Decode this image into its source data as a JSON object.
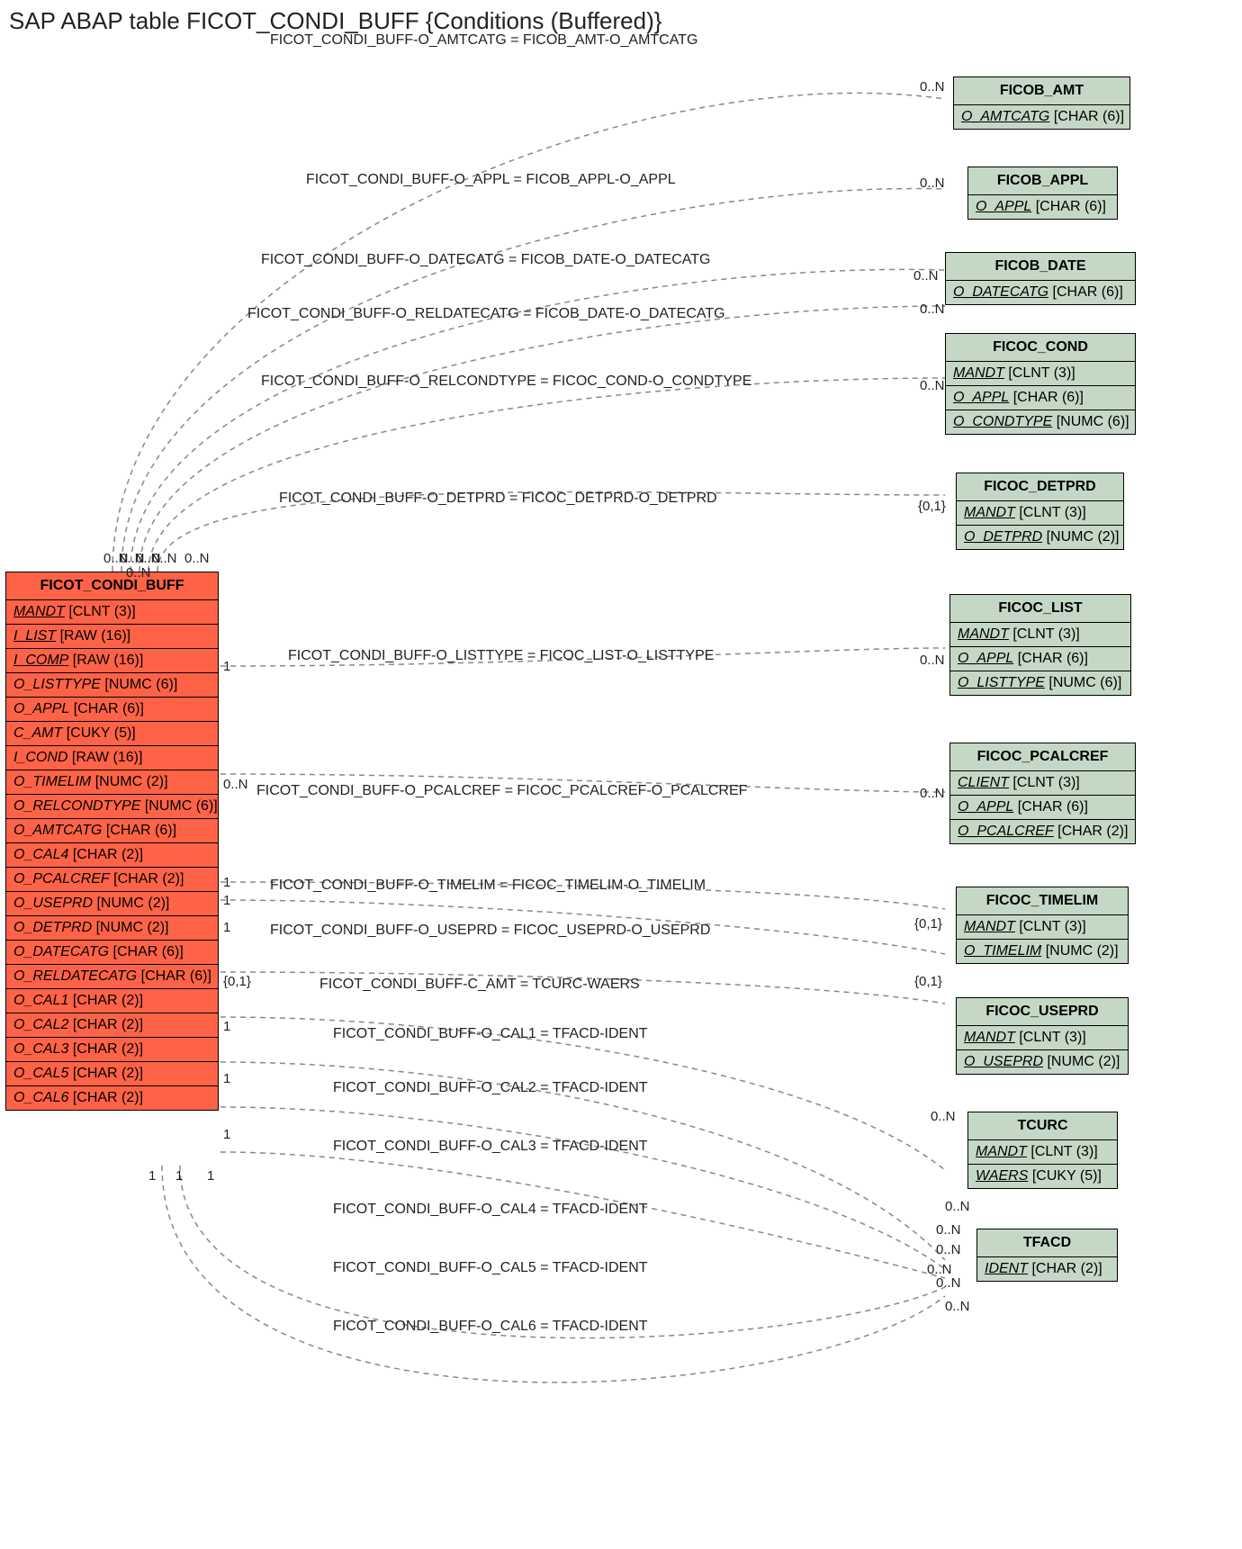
{
  "title": "SAP ABAP table FICOT_CONDI_BUFF {Conditions (Buffered)}",
  "main": {
    "name": "FICOT_CONDI_BUFF",
    "fields": [
      {
        "name": "MANDT",
        "type": "[CLNT (3)]",
        "key": true
      },
      {
        "name": "I_LIST",
        "type": "[RAW (16)]",
        "key": true
      },
      {
        "name": "I_COMP",
        "type": "[RAW (16)]",
        "key": true
      },
      {
        "name": "O_LISTTYPE",
        "type": "[NUMC (6)]",
        "key": false
      },
      {
        "name": "O_APPL",
        "type": "[CHAR (6)]",
        "key": false
      },
      {
        "name": "C_AMT",
        "type": "[CUKY (5)]",
        "key": false
      },
      {
        "name": "I_COND",
        "type": "[RAW (16)]",
        "key": false
      },
      {
        "name": "O_TIMELIM",
        "type": "[NUMC (2)]",
        "key": false
      },
      {
        "name": "O_RELCONDTYPE",
        "type": "[NUMC (6)]",
        "key": false
      },
      {
        "name": "O_AMTCATG",
        "type": "[CHAR (6)]",
        "key": false
      },
      {
        "name": "O_CAL4",
        "type": "[CHAR (2)]",
        "key": false
      },
      {
        "name": "O_PCALCREF",
        "type": "[CHAR (2)]",
        "key": false
      },
      {
        "name": "O_USEPRD",
        "type": "[NUMC (2)]",
        "key": false
      },
      {
        "name": "O_DETPRD",
        "type": "[NUMC (2)]",
        "key": false
      },
      {
        "name": "O_DATECATG",
        "type": "[CHAR (6)]",
        "key": false
      },
      {
        "name": "O_RELDATECATG",
        "type": "[CHAR (6)]",
        "key": false
      },
      {
        "name": "O_CAL1",
        "type": "[CHAR (2)]",
        "key": false
      },
      {
        "name": "O_CAL2",
        "type": "[CHAR (2)]",
        "key": false
      },
      {
        "name": "O_CAL3",
        "type": "[CHAR (2)]",
        "key": false
      },
      {
        "name": "O_CAL5",
        "type": "[CHAR (2)]",
        "key": false
      },
      {
        "name": "O_CAL6",
        "type": "[CHAR (2)]",
        "key": false
      }
    ]
  },
  "refs": [
    {
      "name": "FICOB_AMT",
      "fields": [
        {
          "name": "O_AMTCATG",
          "type": "[CHAR (6)]",
          "key": true
        }
      ]
    },
    {
      "name": "FICOB_APPL",
      "fields": [
        {
          "name": "O_APPL",
          "type": "[CHAR (6)]",
          "key": true
        }
      ]
    },
    {
      "name": "FICOB_DATE",
      "fields": [
        {
          "name": "O_DATECATG",
          "type": "[CHAR (6)]",
          "key": true
        }
      ]
    },
    {
      "name": "FICOC_COND",
      "fields": [
        {
          "name": "MANDT",
          "type": "[CLNT (3)]",
          "key": true
        },
        {
          "name": "O_APPL",
          "type": "[CHAR (6)]",
          "key": true
        },
        {
          "name": "O_CONDTYPE",
          "type": "[NUMC (6)]",
          "key": true
        }
      ]
    },
    {
      "name": "FICOC_DETPRD",
      "fields": [
        {
          "name": "MANDT",
          "type": "[CLNT (3)]",
          "key": true
        },
        {
          "name": "O_DETPRD",
          "type": "[NUMC (2)]",
          "key": true
        }
      ]
    },
    {
      "name": "FICOC_LIST",
      "fields": [
        {
          "name": "MANDT",
          "type": "[CLNT (3)]",
          "key": true
        },
        {
          "name": "O_APPL",
          "type": "[CHAR (6)]",
          "key": true
        },
        {
          "name": "O_LISTTYPE",
          "type": "[NUMC (6)]",
          "key": true
        }
      ]
    },
    {
      "name": "FICOC_PCALCREF",
      "fields": [
        {
          "name": "CLIENT",
          "type": "[CLNT (3)]",
          "key": true
        },
        {
          "name": "O_APPL",
          "type": "[CHAR (6)]",
          "key": true
        },
        {
          "name": "O_PCALCREF",
          "type": "[CHAR (2)]",
          "key": true
        }
      ]
    },
    {
      "name": "FICOC_TIMELIM",
      "fields": [
        {
          "name": "MANDT",
          "type": "[CLNT (3)]",
          "key": true
        },
        {
          "name": "O_TIMELIM",
          "type": "[NUMC (2)]",
          "key": true
        }
      ]
    },
    {
      "name": "FICOC_USEPRD",
      "fields": [
        {
          "name": "MANDT",
          "type": "[CLNT (3)]",
          "key": true
        },
        {
          "name": "O_USEPRD",
          "type": "[NUMC (2)]",
          "key": true
        }
      ]
    },
    {
      "name": "TCURC",
      "fields": [
        {
          "name": "MANDT",
          "type": "[CLNT (3)]",
          "key": true
        },
        {
          "name": "WAERS",
          "type": "[CUKY (5)]",
          "key": true
        }
      ]
    },
    {
      "name": "TFACD",
      "fields": [
        {
          "name": "IDENT",
          "type": "[CHAR (2)]",
          "key": true
        }
      ]
    }
  ],
  "rels": [
    {
      "label": "FICOT_CONDI_BUFF-O_AMTCATG = FICOB_AMT-O_AMTCATG"
    },
    {
      "label": "FICOT_CONDI_BUFF-O_APPL = FICOB_APPL-O_APPL"
    },
    {
      "label": "FICOT_CONDI_BUFF-O_DATECATG = FICOB_DATE-O_DATECATG"
    },
    {
      "label": "FICOT_CONDI_BUFF-O_RELDATECATG = FICOB_DATE-O_DATECATG"
    },
    {
      "label": "FICOT_CONDI_BUFF-O_RELCONDTYPE = FICOC_COND-O_CONDTYPE"
    },
    {
      "label": "FICOT_CONDI_BUFF-O_DETPRD = FICOC_DETPRD-O_DETPRD"
    },
    {
      "label": "FICOT_CONDI_BUFF-O_LISTTYPE = FICOC_LIST-O_LISTTYPE"
    },
    {
      "label": "FICOT_CONDI_BUFF-O_PCALCREF = FICOC_PCALCREF-O_PCALCREF"
    },
    {
      "label": "FICOT_CONDI_BUFF-O_TIMELIM = FICOC_TIMELIM-O_TIMELIM"
    },
    {
      "label": "FICOT_CONDI_BUFF-O_USEPRD = FICOC_USEPRD-O_USEPRD"
    },
    {
      "label": "FICOT_CONDI_BUFF-C_AMT = TCURC-WAERS"
    },
    {
      "label": "FICOT_CONDI_BUFF-O_CAL1 = TFACD-IDENT"
    },
    {
      "label": "FICOT_CONDI_BUFF-O_CAL2 = TFACD-IDENT"
    },
    {
      "label": "FICOT_CONDI_BUFF-O_CAL3 = TFACD-IDENT"
    },
    {
      "label": "FICOT_CONDI_BUFF-O_CAL4 = TFACD-IDENT"
    },
    {
      "label": "FICOT_CONDI_BUFF-O_CAL5 = TFACD-IDENT"
    },
    {
      "label": "FICOT_CONDI_BUFF-O_CAL6 = TFACD-IDENT"
    }
  ],
  "card": {
    "one": "1",
    "zero_n": "0..N",
    "zero_one": "{0,1}"
  }
}
